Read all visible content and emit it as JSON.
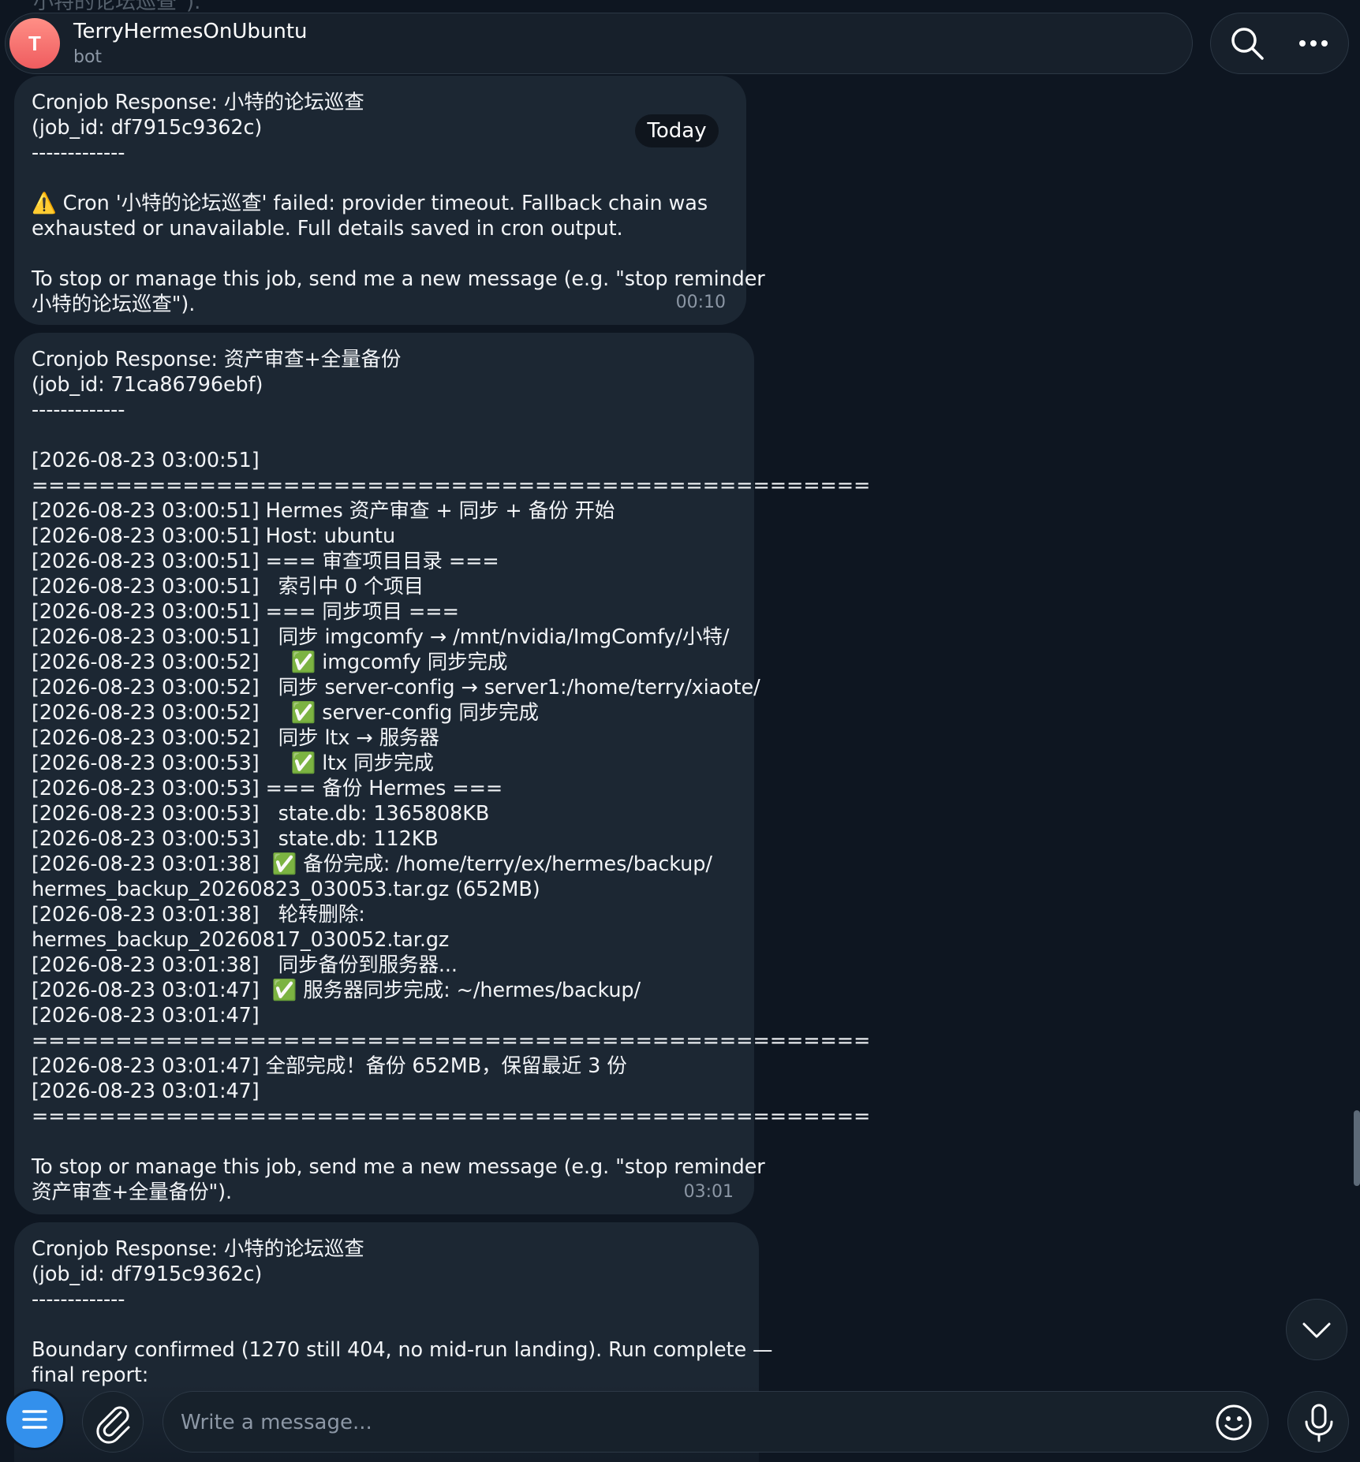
{
  "header": {
    "avatar_letter": "T",
    "title": "TerryHermesOnUbuntu",
    "subtitle": "bot",
    "search_icon": "search-icon",
    "more_icon": "more-horizontal-icon"
  },
  "top_partial_text": "小特的论坛巡查\").",
  "date_pill": "Today",
  "messages": [
    {
      "lines": [
        "Cronjob Response: 小特的论坛巡查",
        "(job_id: df7915c9362c)",
        "-------------",
        "",
        "⚠️ Cron '小特的论坛巡查' failed: provider timeout. Fallback chain was",
        "exhausted or unavailable. Full details saved in cron output.",
        "",
        "To stop or manage this job, send me a new message (e.g. \"stop reminder",
        "小特的论坛巡查\")."
      ],
      "time": "00:10"
    },
    {
      "lines": [
        "Cronjob Response: 资产审查+全量备份",
        "(job_id: 71ca86796ebf)",
        "-------------",
        "",
        "[2026-08-23 03:00:51]",
        "==================================================",
        "[2026-08-23 03:00:51] Hermes 资产审查 + 同步 + 备份 开始",
        "[2026-08-23 03:00:51] Host: ubuntu",
        "[2026-08-23 03:00:51] === 审查项目目录 ===",
        "[2026-08-23 03:00:51]   索引中 0 个项目",
        "[2026-08-23 03:00:51] === 同步项目 ===",
        "[2026-08-23 03:00:51]   同步 imgcomfy → /mnt/nvidia/ImgComfy/小特/",
        "[2026-08-23 03:00:52]     ✅ imgcomfy 同步完成",
        "[2026-08-23 03:00:52]   同步 server-config → server1:/home/terry/xiaote/",
        "[2026-08-23 03:00:52]     ✅ server-config 同步完成",
        "[2026-08-23 03:00:52]   同步 ltx → 服务器",
        "[2026-08-23 03:00:53]     ✅ ltx 同步完成",
        "[2026-08-23 03:00:53] === 备份 Hermes ===",
        "[2026-08-23 03:00:53]   state.db: 1365808KB",
        "[2026-08-23 03:00:53]   state.db: 112KB",
        "[2026-08-23 03:01:38]  ✅ 备份完成: /home/terry/ex/hermes/backup/",
        "hermes_backup_20260823_030053.tar.gz (652MB)",
        "[2026-08-23 03:01:38]   轮转删除:",
        "hermes_backup_20260817_030052.tar.gz",
        "[2026-08-23 03:01:38]   同步备份到服务器...",
        "[2026-08-23 03:01:47]  ✅ 服务器同步完成: ~/hermes/backup/",
        "[2026-08-23 03:01:47]",
        "==================================================",
        "[2026-08-23 03:01:47] 全部完成！备份 652MB，保留最近 3 份",
        "[2026-08-23 03:01:47]",
        "==================================================",
        "",
        "To stop or manage this job, send me a new message (e.g. \"stop reminder",
        "资产审查+全量备份\")."
      ],
      "time": "03:01"
    },
    {
      "lines": [
        "Cronjob Response: 小特的论坛巡查",
        "(job_id: df7915c9362c)",
        "-------------",
        "",
        "Boundary confirmed (1270 still 404, no mid-run landing). Run complete —",
        "final report:"
      ],
      "time": ""
    }
  ],
  "composer": {
    "placeholder": "Write a message...",
    "menu_icon": "menu-icon",
    "attach_icon": "paperclip-icon",
    "emoji_icon": "emoji-icon",
    "mic_icon": "microphone-icon"
  },
  "scroll_icon": "chevron-down-icon",
  "colors": {
    "background": "#0e1621",
    "bubble": "#1c2733",
    "accent": "#3390ec",
    "muted_text": "#8c97a5"
  }
}
